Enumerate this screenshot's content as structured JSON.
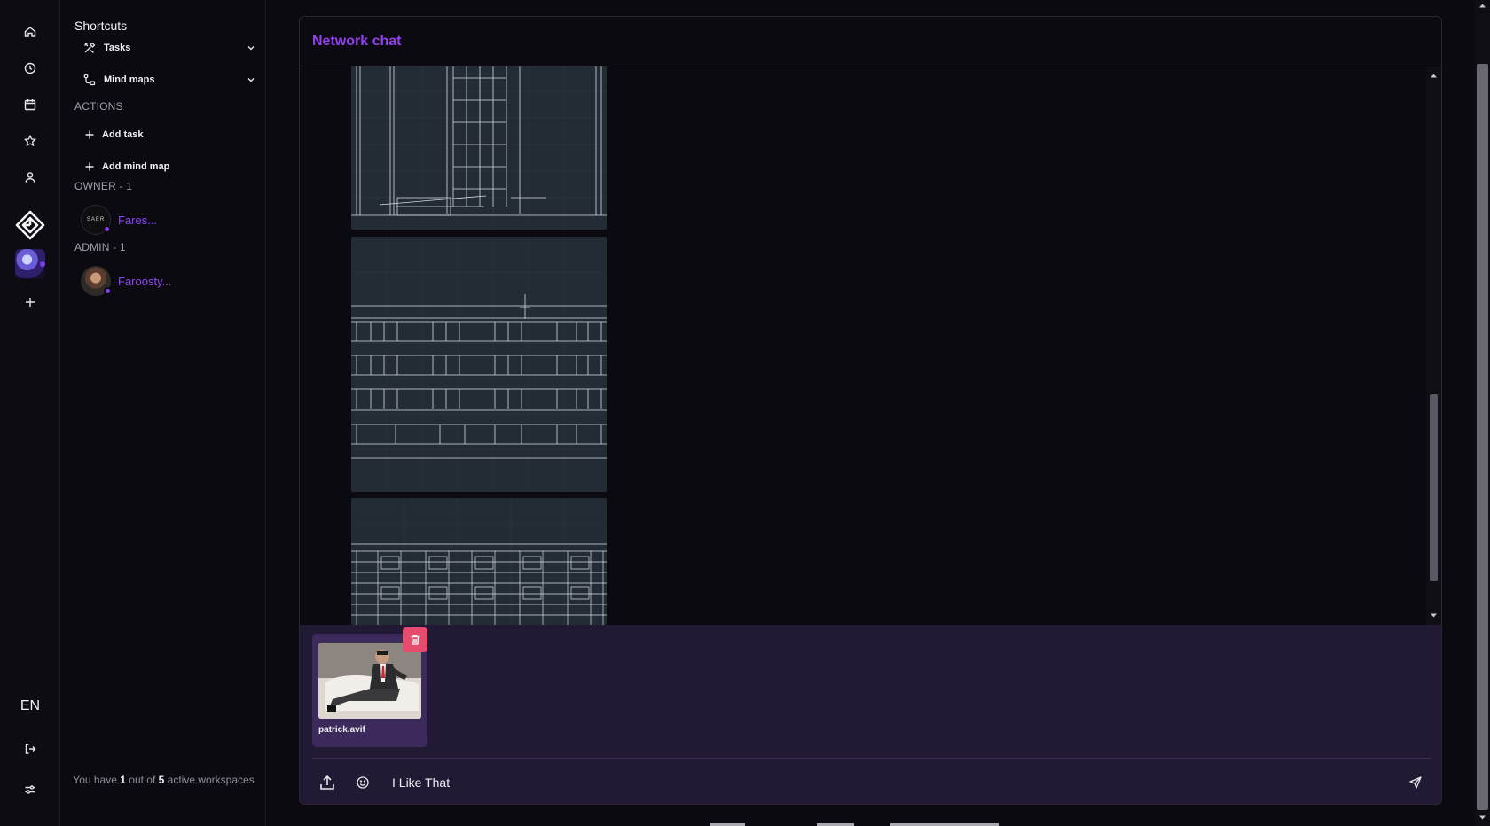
{
  "rail": {
    "items": [
      "home-icon",
      "clock-icon",
      "calendar-icon",
      "star-icon",
      "user-icon"
    ],
    "language": "EN"
  },
  "sidebar": {
    "shortcuts_title": "Shortcuts",
    "shortcuts": [
      {
        "label": "Tasks",
        "icon": "tools-icon"
      },
      {
        "label": "Mind maps",
        "icon": "mindmap-icon"
      }
    ],
    "actions_label": "ACTIONS",
    "actions": [
      {
        "label": "Add task"
      },
      {
        "label": "Add mind map"
      }
    ],
    "owner_label": "OWNER - 1",
    "owner": {
      "name": "Fares...",
      "avatar_text": "SAER"
    },
    "admin_label": "ADMIN - 1",
    "admin": {
      "name": "Faroosty..."
    },
    "workspaces_note": {
      "prefix": "You have ",
      "count": "1",
      "middle": " out of ",
      "total": "5",
      "suffix": " active workspaces"
    }
  },
  "chat": {
    "title": "Network chat",
    "attachment": {
      "filename": "patrick.avif"
    },
    "input_value": "I Like That",
    "input_placeholder": ""
  },
  "colors": {
    "accent": "#9440f0",
    "composer_bg": "#221a35",
    "delete": "#e44b6d"
  }
}
